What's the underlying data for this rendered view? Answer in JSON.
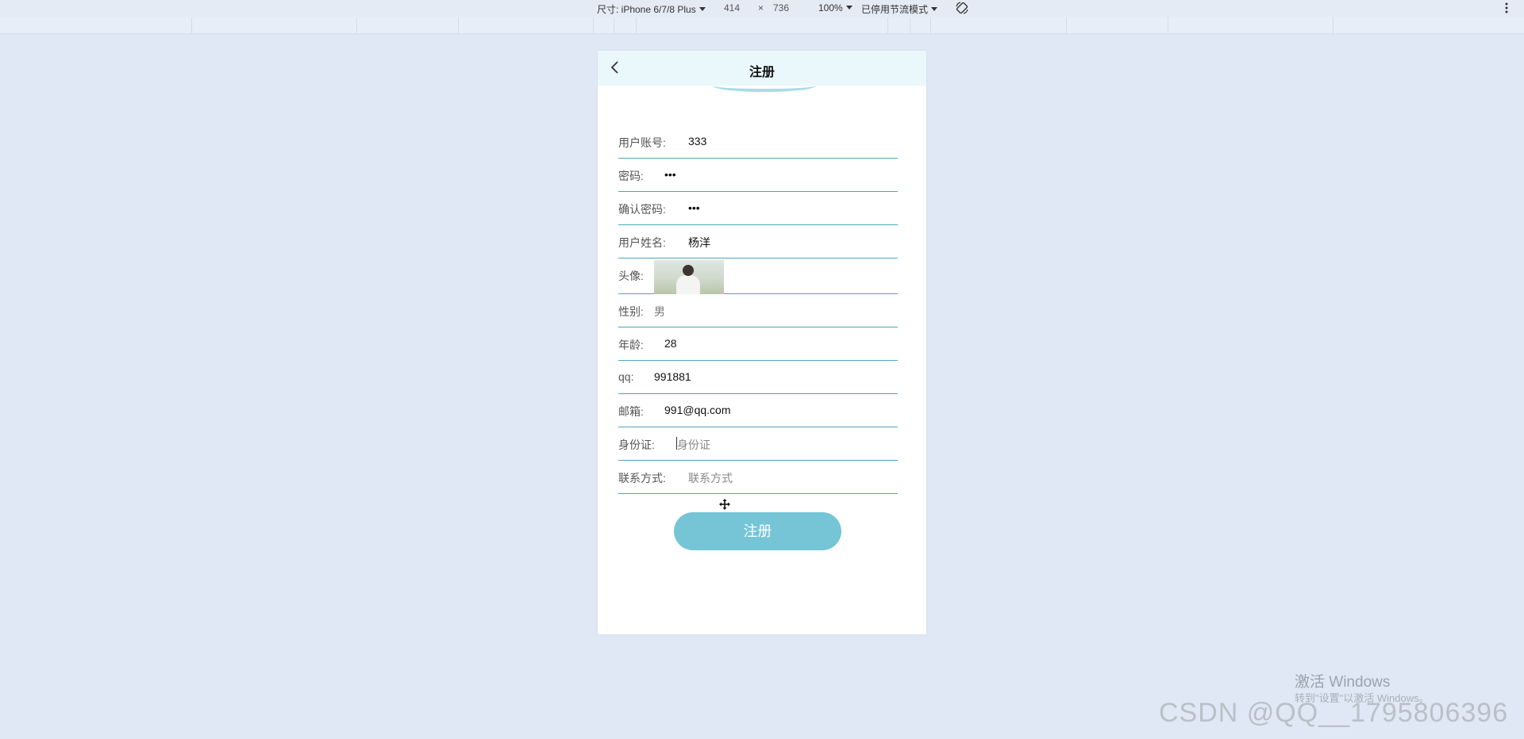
{
  "devtools": {
    "device_label": "尺寸: iPhone 6/7/8 Plus",
    "width": "414",
    "times": "×",
    "height": "736",
    "zoom": "100%",
    "throttle": "已停用节流模式",
    "rotate_icon": "rotate-icon",
    "more_icon": "more-vertical-icon"
  },
  "header": {
    "title": "注册",
    "back_icon": "chevron-left-icon"
  },
  "form": {
    "account": {
      "label": "用户账号:",
      "value": "333"
    },
    "password": {
      "label": "密码:",
      "value": "•••"
    },
    "confirm_password": {
      "label": "确认密码:",
      "value": "•••"
    },
    "name": {
      "label": "用户姓名:",
      "value": "杨洋"
    },
    "avatar": {
      "label": "头像:"
    },
    "gender": {
      "label": "性别:",
      "value": "男"
    },
    "age": {
      "label": "年龄:",
      "value": "28"
    },
    "qq": {
      "label": "qq:",
      "value": "991881"
    },
    "email": {
      "label": "邮箱:",
      "value": "991@qq.com"
    },
    "id_card": {
      "label": "身份证:",
      "placeholder": "身份证"
    },
    "contact": {
      "label": "联系方式:",
      "placeholder": "联系方式"
    }
  },
  "submit_label": "注册",
  "watermark": {
    "line1": "激活 Windows",
    "line2": "转到\"设置\"以激活 Windows。",
    "csdn": "CSDN @QQ__1795806396"
  },
  "colors": {
    "background": "#dfe8f4",
    "accent": "#75c5d6",
    "underline": "#4aa6bd",
    "header_bg": "#eaf8fb"
  }
}
